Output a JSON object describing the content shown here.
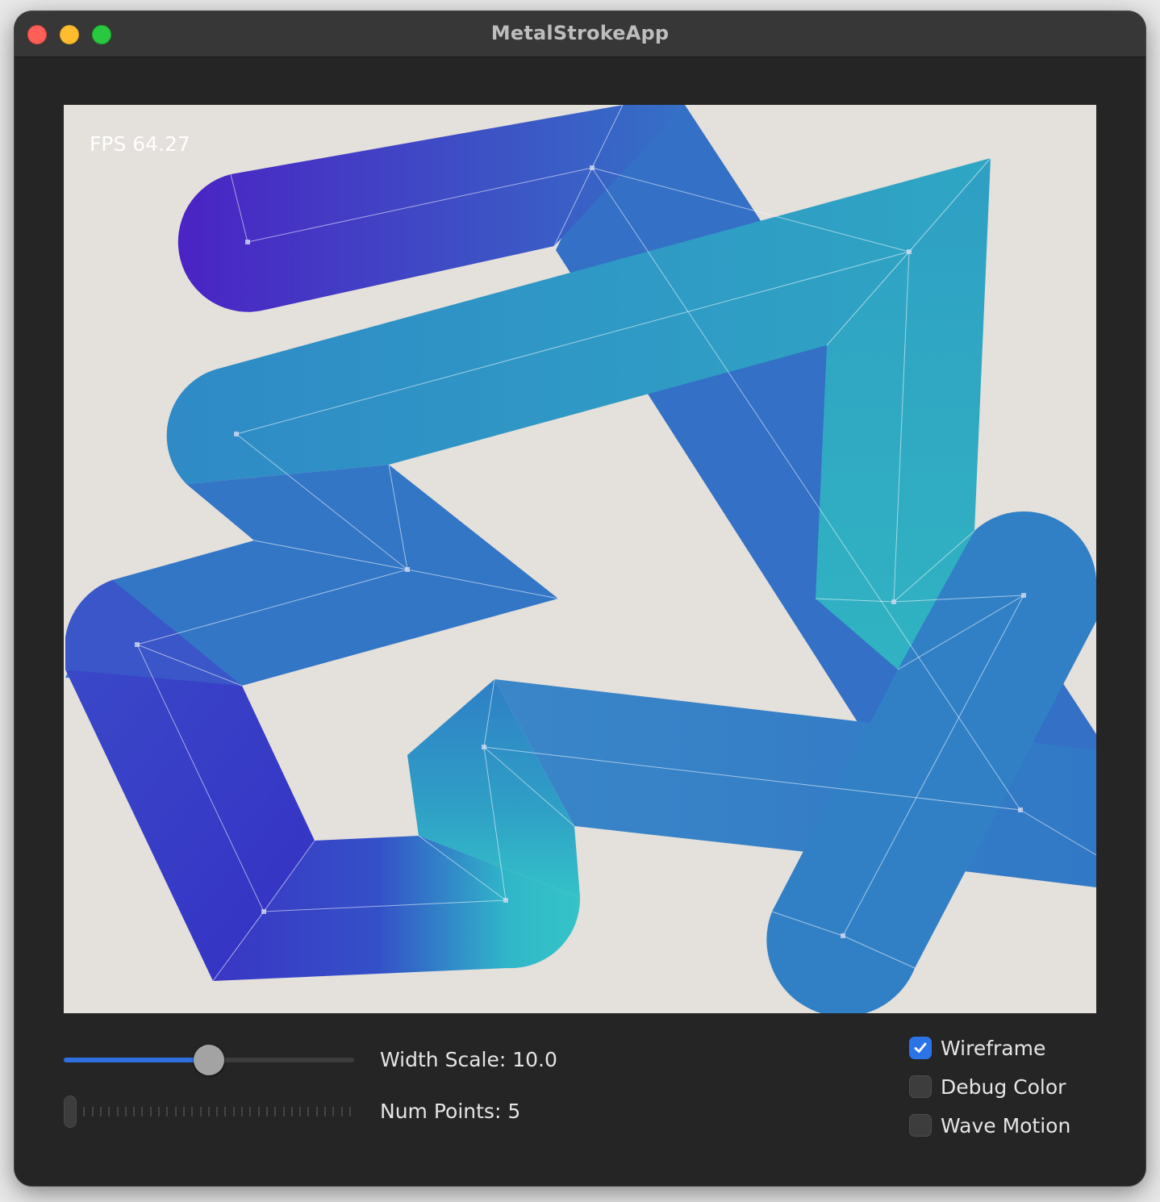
{
  "window": {
    "title": "MetalStrokeApp"
  },
  "canvas": {
    "fps_text": "FPS 64.27",
    "background": "#e4e0db",
    "gradient_colors": [
      "#4a23c4",
      "#3366c8",
      "#2fb3c4",
      "#3c3ac9"
    ]
  },
  "controls": {
    "width_scale": {
      "label": "Width Scale: 10.0",
      "value_fraction": 0.5
    },
    "num_points": {
      "label": "Num Points: 5",
      "value_fraction": 0.0
    },
    "wireframe": {
      "label": "Wireframe",
      "checked": true
    },
    "debug_color": {
      "label": "Debug Color",
      "checked": false
    },
    "wave_motion": {
      "label": "Wave Motion",
      "checked": false
    }
  },
  "colors": {
    "accent": "#2c74e6",
    "window_bg": "#252525",
    "titlebar_bg": "#373737"
  }
}
